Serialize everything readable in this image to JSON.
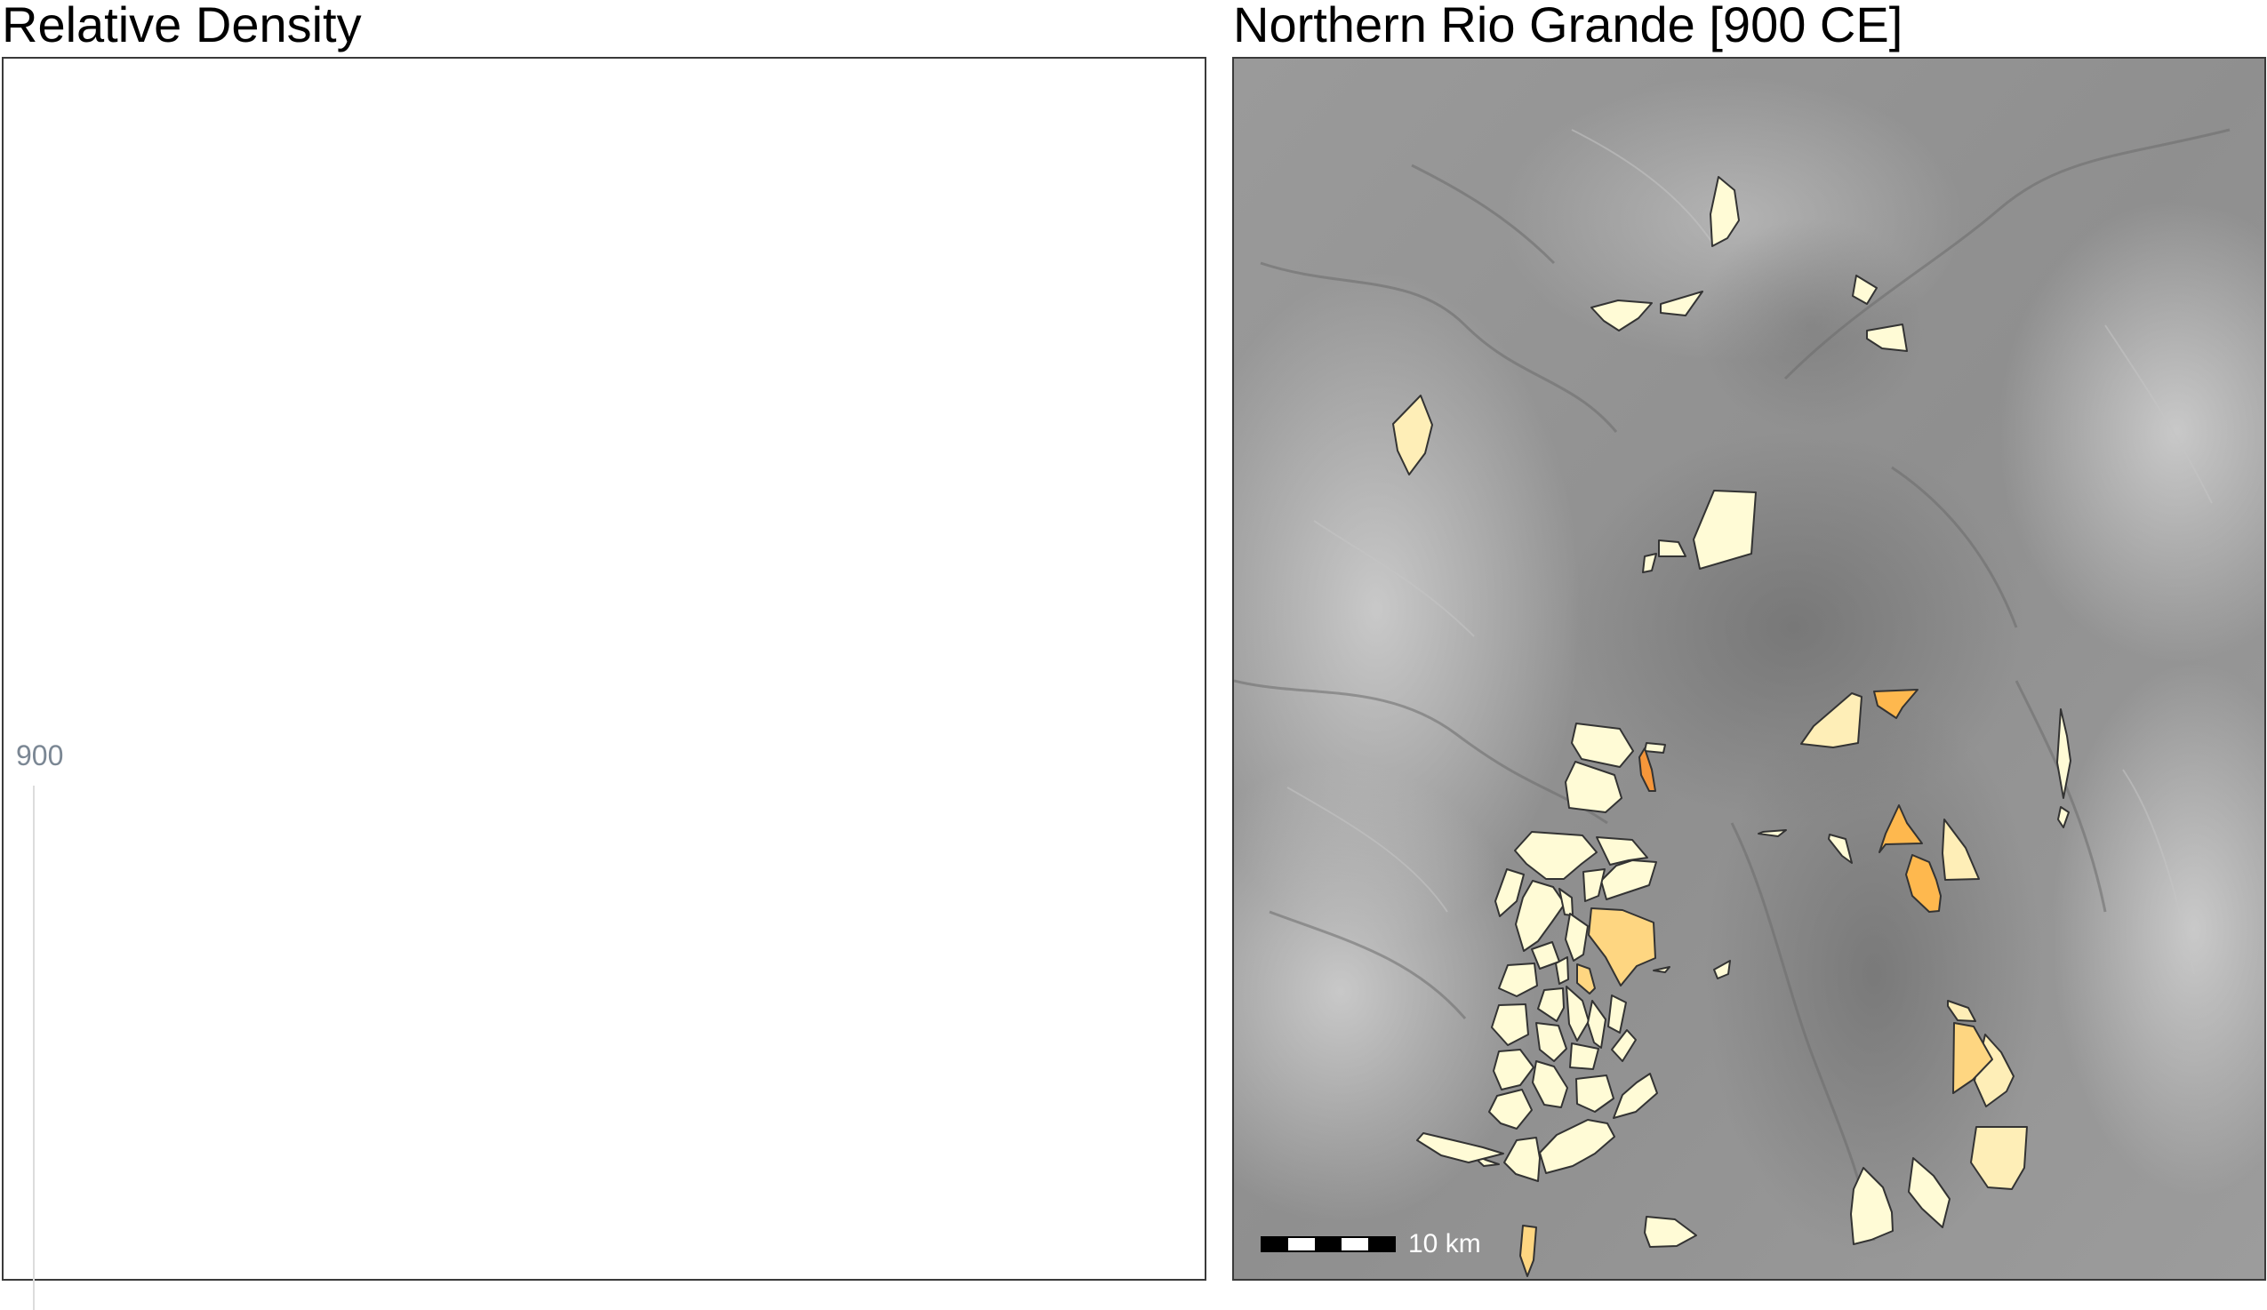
{
  "left_panel": {
    "title": "Relative Density",
    "axis_tick_label": "900"
  },
  "right_panel": {
    "title": "Northern Rio Grande [900 CE]",
    "scale_bar": {
      "label": "10 km",
      "segments": 5
    },
    "basemap": "hillshade-relief"
  },
  "density_colors": {
    "lowest": "#fffbd6",
    "low": "#feeeb7",
    "medium": "#fed681",
    "high": "#feb84e",
    "highest": "#f6963a"
  }
}
